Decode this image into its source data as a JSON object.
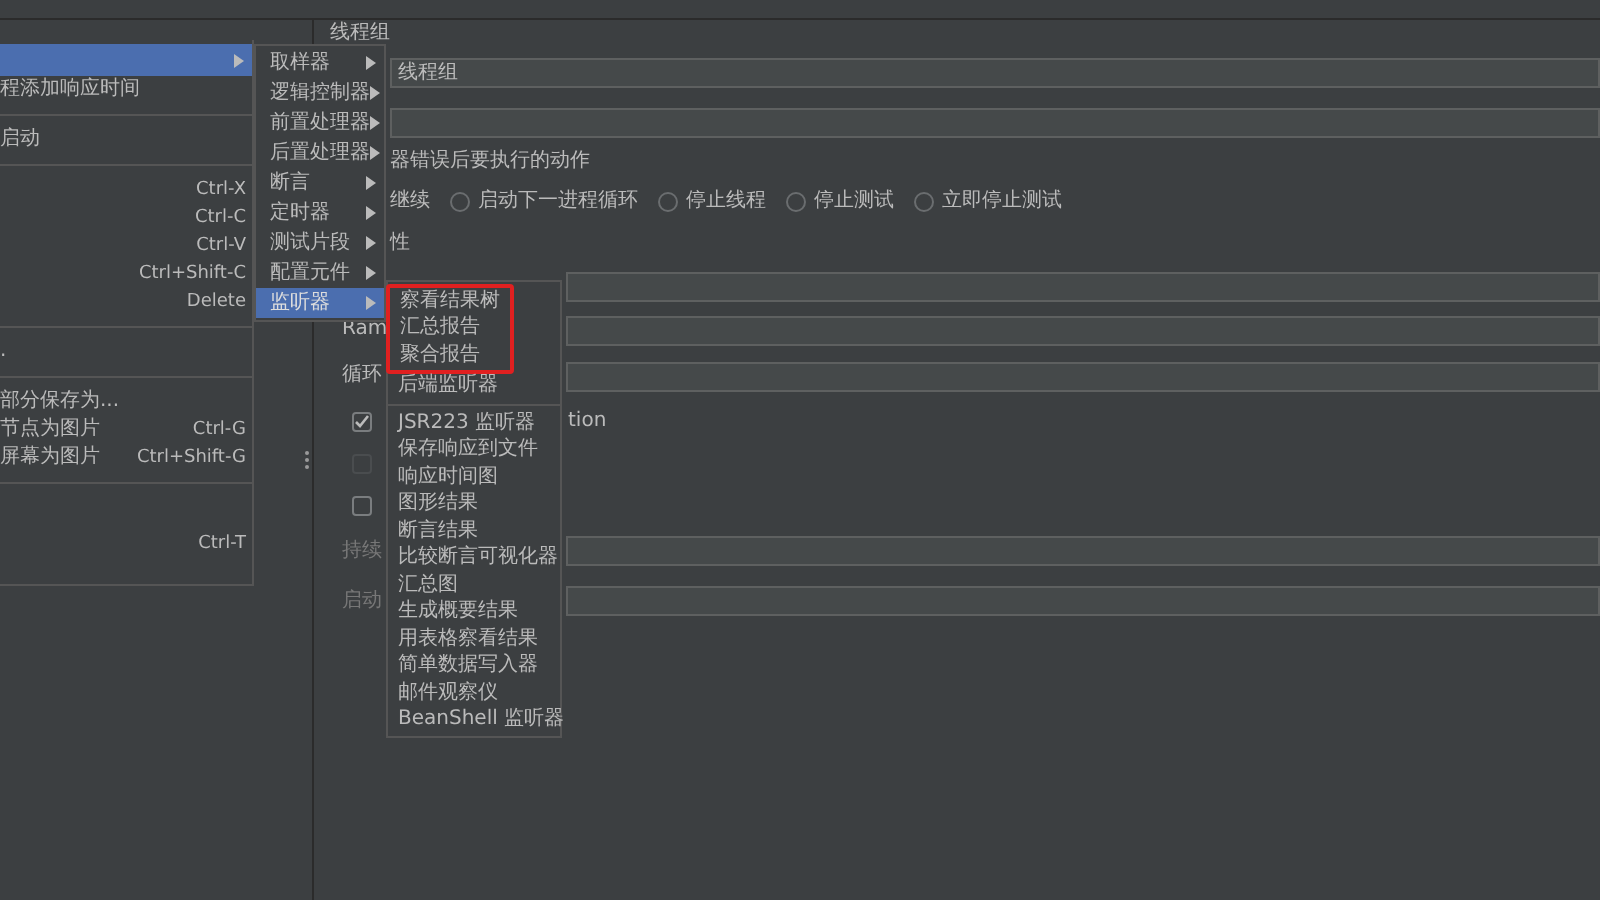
{
  "main_menu": [
    {
      "kind": "submenu",
      "selected": true
    },
    {
      "kind": "item",
      "label": "程添加响应时间"
    },
    {
      "kind": "separator"
    },
    {
      "kind": "item",
      "label": "启动"
    },
    {
      "kind": "separator"
    },
    {
      "kind": "item",
      "shortcut": "Ctrl-X"
    },
    {
      "kind": "item",
      "shortcut": "Ctrl-C"
    },
    {
      "kind": "item",
      "shortcut": "Ctrl-V"
    },
    {
      "kind": "item",
      "shortcut": "Ctrl+Shift-C"
    },
    {
      "kind": "item",
      "shortcut": "Delete"
    },
    {
      "kind": "separator"
    },
    {
      "kind": "item",
      "label": "."
    },
    {
      "kind": "separator"
    },
    {
      "kind": "item",
      "label": "部分保存为..."
    },
    {
      "kind": "item",
      "label": "节点为图片",
      "shortcut": "Ctrl-G"
    },
    {
      "kind": "item",
      "label": "屏幕为图片",
      "shortcut": "Ctrl+Shift-G"
    },
    {
      "kind": "separator"
    },
    {
      "kind": "spacer"
    },
    {
      "kind": "item",
      "shortcut": "Ctrl-T"
    }
  ],
  "add_menu": [
    {
      "label": "取样器",
      "selected": false
    },
    {
      "label": "逻辑控制器",
      "selected": false
    },
    {
      "label": "前置处理器",
      "selected": false
    },
    {
      "label": "后置处理器",
      "selected": false
    },
    {
      "label": "断言",
      "selected": false
    },
    {
      "label": "定时器",
      "selected": false
    },
    {
      "label": "测试片段",
      "selected": false
    },
    {
      "label": "配置元件",
      "selected": false
    },
    {
      "label": "监听器",
      "selected": true
    }
  ],
  "listener_menu": [
    {
      "kind": "item",
      "label": "察看结果树",
      "marked": true
    },
    {
      "kind": "item",
      "label": "汇总报告",
      "marked": true
    },
    {
      "kind": "item",
      "label": "聚合报告",
      "marked": true
    },
    {
      "kind": "item",
      "label": "后端监听器",
      "marked": false
    },
    {
      "kind": "separator"
    },
    {
      "kind": "item",
      "label": "JSR223 监听器",
      "marked": false
    },
    {
      "kind": "item",
      "label": "保存响应到文件",
      "marked": false
    },
    {
      "kind": "item",
      "label": "响应时间图",
      "marked": false
    },
    {
      "kind": "item",
      "label": "图形结果",
      "marked": false
    },
    {
      "kind": "item",
      "label": "断言结果",
      "marked": false
    },
    {
      "kind": "item",
      "label": "比较断言可视化器",
      "marked": false
    },
    {
      "kind": "item",
      "label": "汇总图",
      "marked": false
    },
    {
      "kind": "item",
      "label": "生成概要结果",
      "marked": false
    },
    {
      "kind": "item",
      "label": "用表格察看结果",
      "marked": false
    },
    {
      "kind": "item",
      "label": "简单数据写入器",
      "marked": false
    },
    {
      "kind": "item",
      "label": "邮件观察仪",
      "marked": false
    },
    {
      "kind": "item",
      "label": "BeanShell 监听器",
      "marked": false
    }
  ],
  "panel": {
    "title": "线程组",
    "name_value": "线程组",
    "error_action_label": "器错误后要执行的动作",
    "continue_label": "继续",
    "error_actions": [
      {
        "label": "启动下一进程循环",
        "selected": false
      },
      {
        "label": "停止线程",
        "selected": false
      },
      {
        "label": "停止测试",
        "selected": false
      },
      {
        "label": "立即停止测试",
        "selected": false
      }
    ],
    "section_label": "性",
    "ramp_label": "Ram",
    "loop_label": "循环",
    "options": [
      {
        "label": "tion",
        "checked": true,
        "disabled": false
      },
      {
        "checked": false,
        "disabled": true
      },
      {
        "checked": false,
        "disabled": false
      }
    ],
    "duration_label": "持续",
    "delay_label": "启动"
  }
}
